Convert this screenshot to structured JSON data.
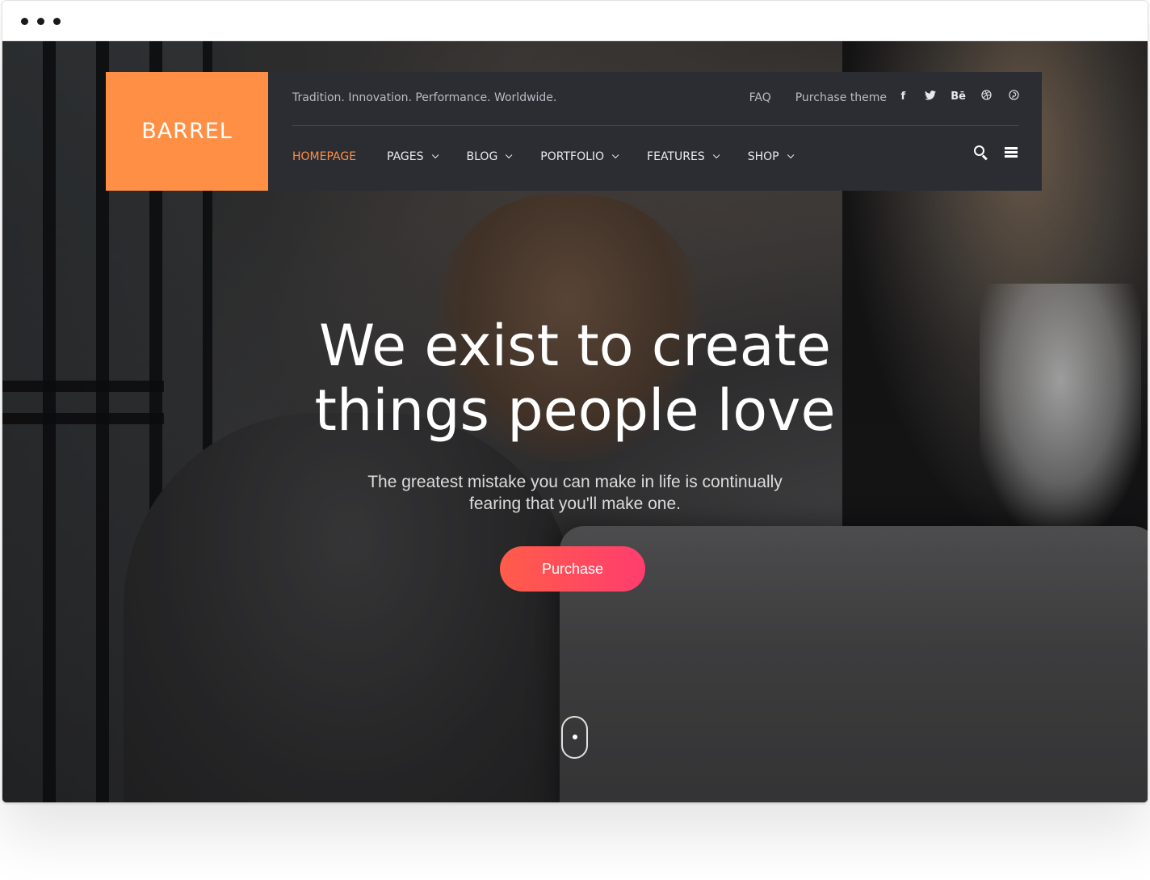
{
  "brand": {
    "name": "BARREL",
    "accent_color": "#ff8f44"
  },
  "header": {
    "tagline": "Tradition. Innovation. Performance. Worldwide.",
    "top_links": [
      {
        "label": "FAQ"
      },
      {
        "label": "Purchase theme"
      }
    ],
    "socials": [
      {
        "icon": "facebook-icon",
        "glyph": "f"
      },
      {
        "icon": "twitter-icon",
        "glyph": "🐦"
      },
      {
        "icon": "behance-icon",
        "glyph": "Bē"
      },
      {
        "icon": "dribbble-icon",
        "glyph": "⊛"
      },
      {
        "icon": "pinterest-icon",
        "glyph": "℗"
      }
    ],
    "nav": [
      {
        "label": "HOMEPAGE",
        "active": true,
        "dropdown": false
      },
      {
        "label": "PAGES",
        "active": false,
        "dropdown": true
      },
      {
        "label": "BLOG",
        "active": false,
        "dropdown": true
      },
      {
        "label": "PORTFOLIO",
        "active": false,
        "dropdown": true
      },
      {
        "label": "FEATURES",
        "active": false,
        "dropdown": true
      },
      {
        "label": "SHOP",
        "active": false,
        "dropdown": true
      }
    ]
  },
  "hero": {
    "title_line1": "We exist to create",
    "title_line2": "things people love",
    "subtitle": "The greatest mistake you can make in life is continually fearing that you'll make one.",
    "cta_label": "Purchase",
    "cta_gradient": [
      "#ff5c4a",
      "#ff3d6e"
    ]
  }
}
